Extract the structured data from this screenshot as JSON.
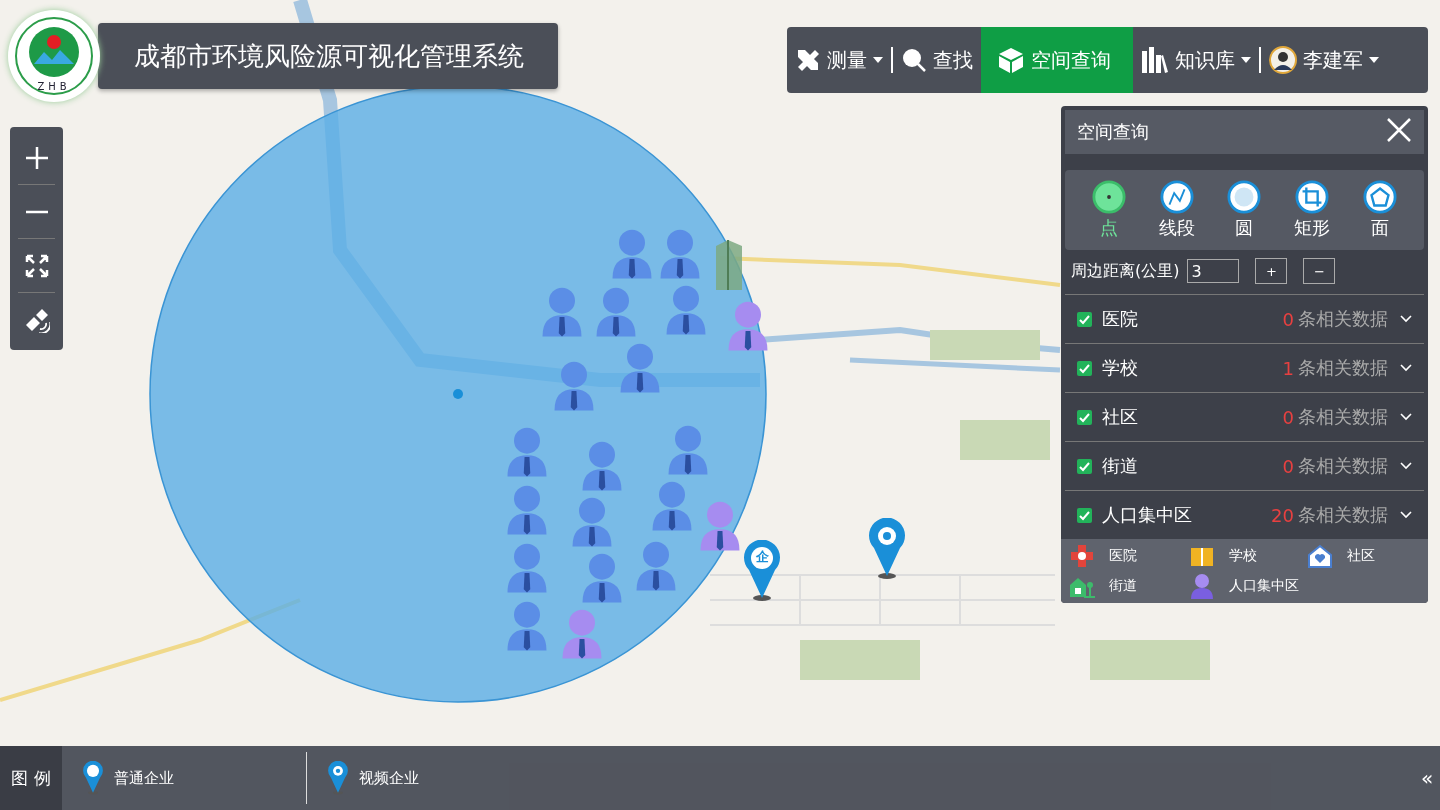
{
  "logo": {
    "text": "ZHB"
  },
  "title": "成都市环境风险源可视化管理系统",
  "toolbar": [
    {
      "kind": "measure",
      "label": "测量",
      "dropdown": true,
      "selected": false
    },
    {
      "kind": "search",
      "label": "查找",
      "dropdown": false,
      "selected": false
    },
    {
      "kind": "cube",
      "label": "空间查询",
      "dropdown": false,
      "selected": true
    },
    {
      "kind": "books",
      "label": "知识库",
      "dropdown": true,
      "selected": false
    },
    {
      "kind": "user",
      "label": "李建军",
      "dropdown": true,
      "selected": false
    }
  ],
  "map_controls": [
    {
      "kind": "zoom-in"
    },
    {
      "kind": "zoom-out"
    },
    {
      "kind": "fullscreen"
    },
    {
      "kind": "satellite"
    }
  ],
  "map": {
    "markers": [
      {
        "kind": "person",
        "color": "#5b8ee6"
      },
      {
        "kind": "person",
        "color": "#5b8ee6"
      },
      {
        "kind": "person",
        "color": "#5b8ee6"
      },
      {
        "kind": "person",
        "color": "#5b8ee6"
      },
      {
        "kind": "person",
        "color": "#5b8ee6"
      },
      {
        "kind": "person",
        "color": "#5b8ee6"
      },
      {
        "kind": "person",
        "color": "#a68cf0"
      },
      {
        "kind": "person",
        "color": "#5b8ee6"
      },
      {
        "kind": "person",
        "color": "#5b8ee6"
      },
      {
        "kind": "person",
        "color": "#5b8ee6"
      },
      {
        "kind": "person",
        "color": "#5b8ee6"
      },
      {
        "kind": "person",
        "color": "#5b8ee6"
      },
      {
        "kind": "person",
        "color": "#5b8ee6"
      },
      {
        "kind": "person",
        "color": "#a68cf0"
      },
      {
        "kind": "person",
        "color": "#5b8ee6"
      },
      {
        "kind": "person",
        "color": "#5b8ee6"
      },
      {
        "kind": "person",
        "color": "#5b8ee6"
      },
      {
        "kind": "person",
        "color": "#a68cf0"
      },
      {
        "kind": "person",
        "color": "#5b8ee6"
      },
      {
        "kind": "person",
        "color": "#5b8ee6"
      },
      {
        "kind": "school"
      },
      {
        "kind": "enterprise",
        "glyph": "企"
      },
      {
        "kind": "video"
      }
    ]
  },
  "panel": {
    "title": "空间查询",
    "tools": [
      {
        "kind": "point",
        "label": "点",
        "selected": true
      },
      {
        "kind": "line",
        "label": "线段",
        "selected": false
      },
      {
        "kind": "circle",
        "label": "圆",
        "selected": false
      },
      {
        "kind": "rectangle",
        "label": "矩形",
        "selected": false
      },
      {
        "kind": "polygon",
        "label": "面",
        "selected": false
      }
    ],
    "distance": {
      "label": "周边距离(公里)",
      "value": "3",
      "plus": "+",
      "minus": "−"
    },
    "categories": [
      {
        "label": "医院",
        "checked": true,
        "count": "0",
        "suffix": "条相关数据"
      },
      {
        "label": "学校",
        "checked": true,
        "count": "1",
        "suffix": "条相关数据"
      },
      {
        "label": "社区",
        "checked": true,
        "count": "0",
        "suffix": "条相关数据"
      },
      {
        "label": "街道",
        "checked": true,
        "count": "0",
        "suffix": "条相关数据"
      },
      {
        "label": "人口集中区",
        "checked": true,
        "count": "20",
        "suffix": "条相关数据"
      }
    ],
    "legend": [
      {
        "kind": "hospital",
        "label": "医院"
      },
      {
        "kind": "school",
        "label": "学校"
      },
      {
        "kind": "community",
        "label": "社区"
      },
      {
        "kind": "street",
        "label": "街道"
      },
      {
        "kind": "population",
        "label": "人口集中区"
      }
    ]
  },
  "bottom_legend": {
    "title": "图 例",
    "items": [
      {
        "kind": "enterprise",
        "label": "普通企业"
      },
      {
        "kind": "video",
        "label": "视频企业"
      }
    ],
    "collapse": "«"
  }
}
